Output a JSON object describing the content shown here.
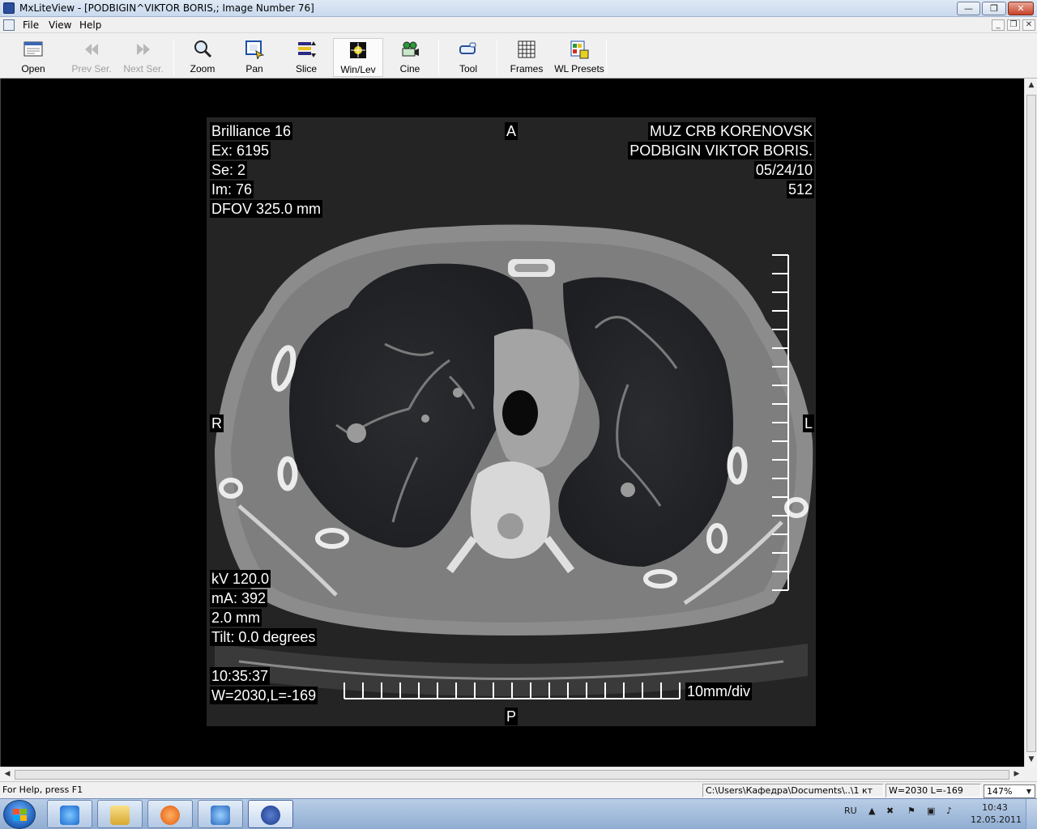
{
  "window": {
    "title": "MxLiteView - [PODBIGIN^VIKTOR BORIS,; Image Number 76]",
    "minimize": "—",
    "maximize": "❐",
    "close": "✕"
  },
  "menu": {
    "items": [
      "File",
      "View",
      "Help"
    ],
    "mdi_minimize": "_",
    "mdi_restore": "❐",
    "mdi_close": "✕"
  },
  "toolbar": {
    "open": "Open",
    "prev_series": "Prev Ser.",
    "next_series": "Next Ser.",
    "zoom": "Zoom",
    "pan": "Pan",
    "slice": "Slice",
    "win_lev": "Win/Lev",
    "cine": "Cine",
    "tool": "Tool",
    "frames": "Frames",
    "wl_presets": "WL Presets",
    "active": "Win/Lev"
  },
  "overlay": {
    "top_left": [
      "Brilliance 16",
      "Ex: 6195",
      "Se: 2",
      "Im: 76",
      "DFOV 325.0 mm"
    ],
    "top_right": [
      "MUZ CRB KORENOVSK",
      "PODBIGIN VIKTOR BORIS.",
      "05/24/10",
      "512"
    ],
    "bottom_left": [
      "kV 120.0",
      "mA:  392",
      "2.0 mm",
      "Tilt: 0.0 degrees"
    ],
    "time": "10:35:37",
    "window_level": "W=2030,L=-169",
    "orientation": {
      "anterior": "A",
      "posterior": "P",
      "right": "R",
      "left": "L"
    },
    "scale_label": "10mm/div"
  },
  "statusbar": {
    "help": "For Help, press F1",
    "path": "C:\\Users\\Кафедра\\Documents\\..\\1 кт",
    "wl": "W=2030 L=-169",
    "zoom": "147%"
  },
  "taskbar": {
    "language": "RU",
    "time": "10:43",
    "date": "12.05.2011",
    "apps": [
      "internet-explorer",
      "file-explorer",
      "media-player",
      "tool-app",
      "philips-mxliteview"
    ]
  },
  "colors": {
    "titlebar": "#c9d9ee",
    "chrome": "#f0f0f0",
    "viewer_bg": "#000000",
    "taskbar": "#8fadd2"
  }
}
